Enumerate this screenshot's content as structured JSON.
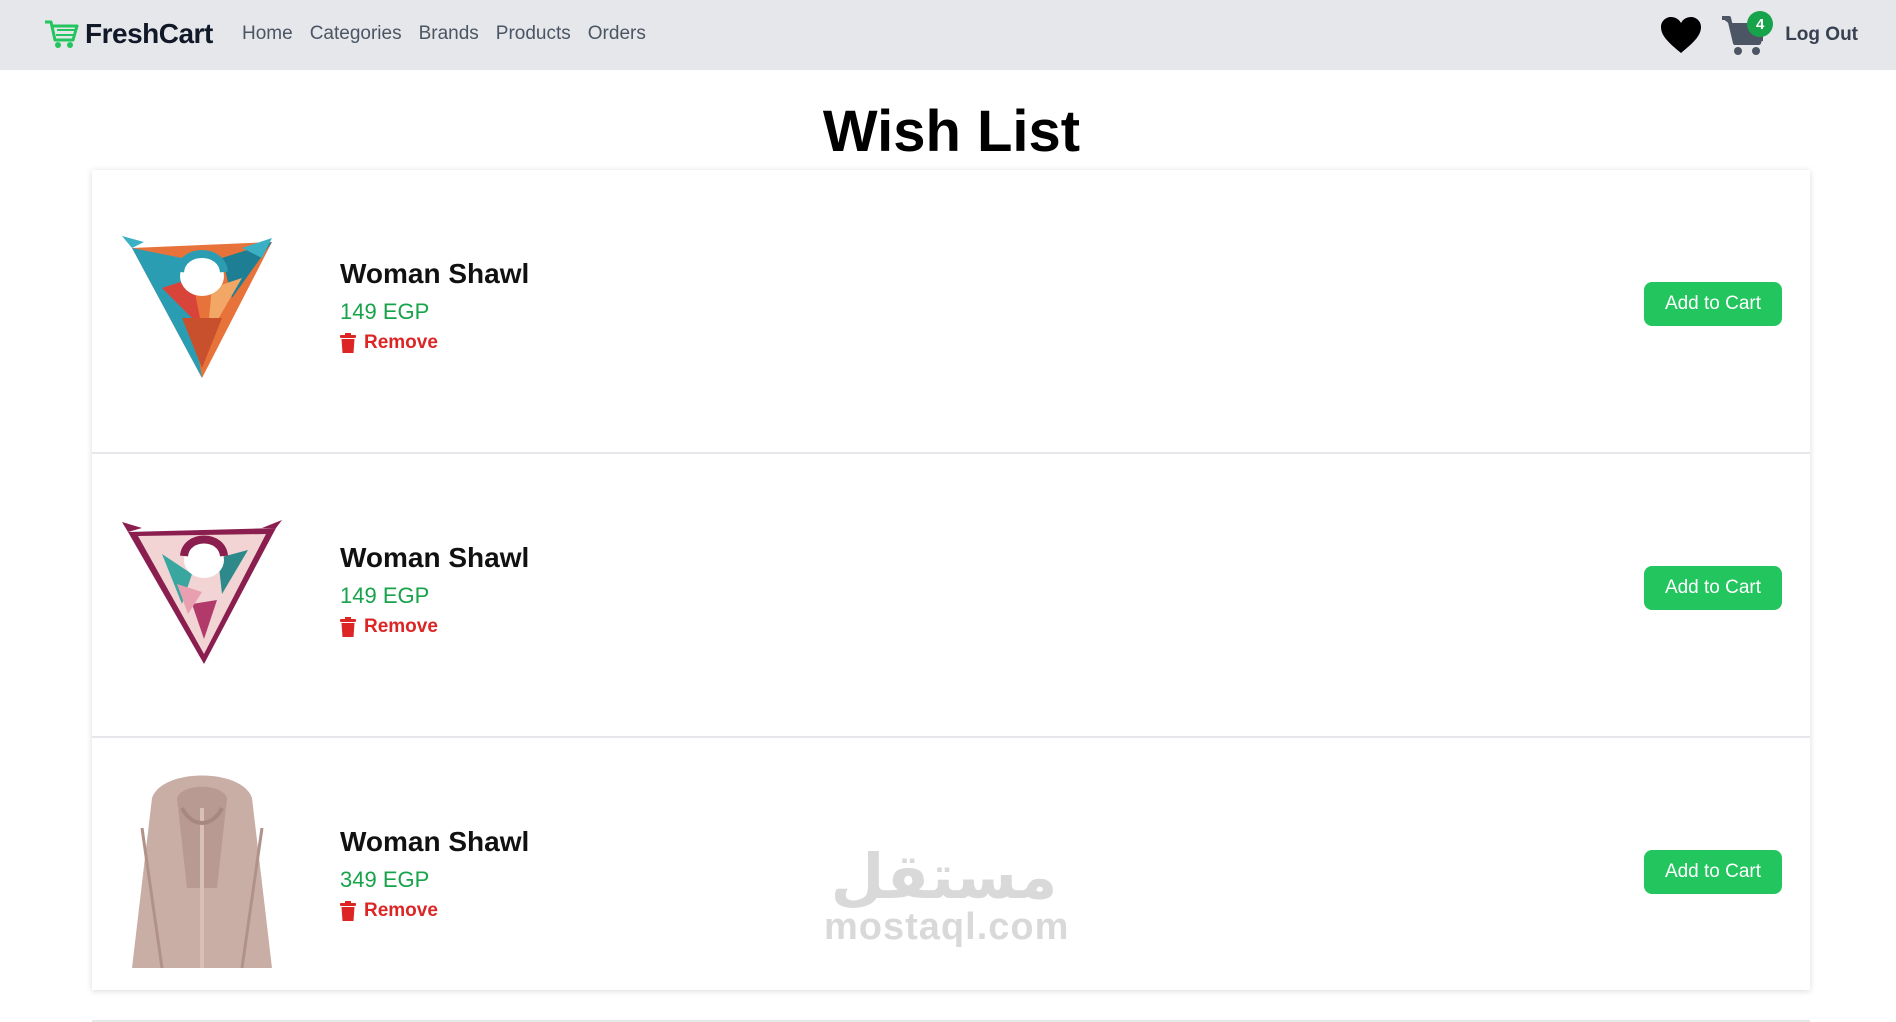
{
  "nav": {
    "brand": "FreshCart",
    "links": [
      "Home",
      "Categories",
      "Brands",
      "Products",
      "Orders"
    ],
    "cart_count": "4",
    "logout": "Log Out"
  },
  "page": {
    "title": "Wish List"
  },
  "items": [
    {
      "name": "Woman Shawl",
      "price": "149 EGP",
      "remove": "Remove",
      "add": "Add to Cart",
      "image": "colorful-shawl-teal-orange"
    },
    {
      "name": "Woman Shawl",
      "price": "149 EGP",
      "remove": "Remove",
      "add": "Add to Cart",
      "image": "floral-shawl-maroon-pink"
    },
    {
      "name": "Woman Shawl",
      "price": "349 EGP",
      "remove": "Remove",
      "add": "Add to Cart",
      "image": "beige-scarf"
    }
  ],
  "watermark": {
    "arabic": "مستقل",
    "latin": "mostaql.com"
  },
  "colors": {
    "navbar": "#e5e7eb",
    "brand_green": "#16a34a",
    "button_green": "#22c55e",
    "price_green": "#16a34a",
    "remove_red": "#dc2626"
  }
}
